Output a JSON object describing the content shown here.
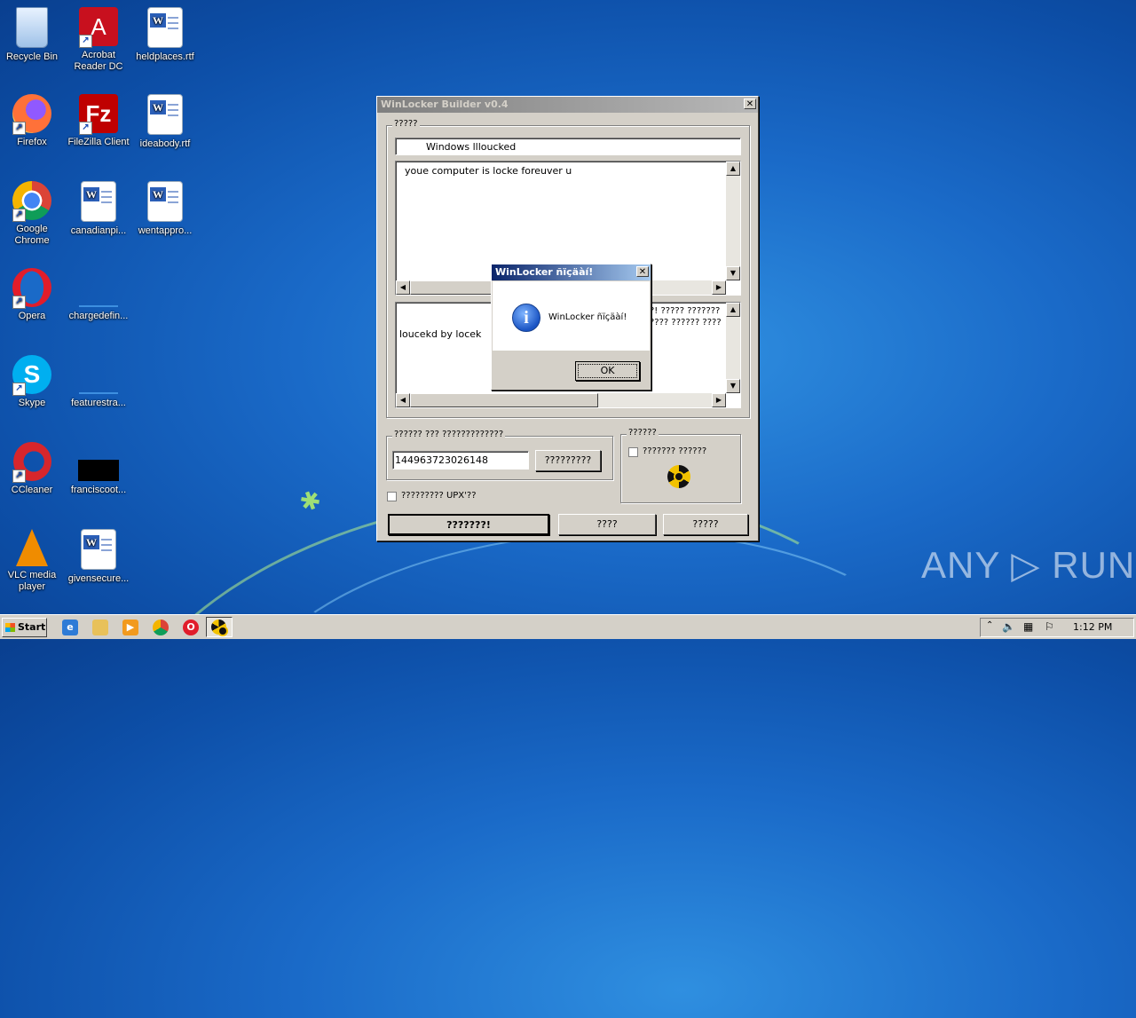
{
  "desktop": {
    "icons": [
      {
        "label": "Recycle Bin"
      },
      {
        "label": "Acrobat Reader DC"
      },
      {
        "label": "heldplaces.rtf"
      },
      {
        "label": "Firefox"
      },
      {
        "label": "FileZilla Client"
      },
      {
        "label": "ideabody.rtf"
      },
      {
        "label": "Google Chrome"
      },
      {
        "label": "canadianpi..."
      },
      {
        "label": "wentappro..."
      },
      {
        "label": "Opera"
      },
      {
        "label": "chargedefin..."
      },
      {
        "label": "Skype"
      },
      {
        "label": "featurestra..."
      },
      {
        "label": "CCleaner"
      },
      {
        "label": "franciscoot..."
      },
      {
        "label": "VLC media player"
      },
      {
        "label": "givensecure..."
      }
    ]
  },
  "builder": {
    "title": "WinLocker Builder v0.4",
    "close_glyph": "✕",
    "text_group_label": "?????",
    "window_title_value": "Windows llloucked",
    "message_value": "youe computer is locke foreuver u",
    "footer_value": "loucekd by locek",
    "footer_hidden_text_1": "?! ????? ???????",
    "footer_hidden_text_2": "???? ?????? ????",
    "code_group_label": "?????? ??? ?????????????",
    "code_value": "144963723026148",
    "generate_label": "?????????",
    "upx_label": "????????? UPX'??",
    "extra_group_label": "??????",
    "extra_checkbox_label": "??????? ??????",
    "build_label": "???????!",
    "button2_label": "????",
    "button3_label": "?????"
  },
  "dialog": {
    "title": "WinLocker ñïçäàí!",
    "message": "WinLocker ñïçäàí!",
    "ok_label": "OK",
    "close_glyph": "✕",
    "info_glyph": "i"
  },
  "taskbar": {
    "start_label": "Start",
    "clock": "1:12 PM"
  },
  "watermark": "ANY ▷ RUN"
}
